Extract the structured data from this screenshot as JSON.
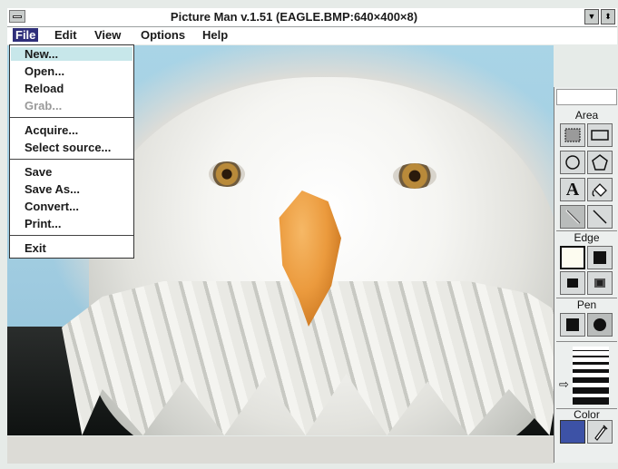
{
  "window": {
    "title": "Picture Man v.1.51 (EAGLE.BMP:640×400×8)",
    "minimize_glyph": "▼",
    "restore_glyph": "⬍",
    "sysmenu_icon": "system-menu-icon"
  },
  "menubar": {
    "items": [
      "File",
      "Edit",
      "View",
      "Options",
      "Help"
    ],
    "active": "File"
  },
  "file_menu": {
    "items": [
      "New...",
      "Open...",
      "Reload",
      "Grab...",
      "Acquire...",
      "Select source...",
      "Save",
      "Save As...",
      "Convert...",
      "Print...",
      "Exit"
    ],
    "disabled": [
      "Grab..."
    ],
    "highlighted": "New..."
  },
  "canvas": {
    "image": "bald eagle portrait",
    "sky_color": "#a9d4e6",
    "beak_color": "#eb9a3d"
  },
  "toolbox": {
    "area_label": "Area",
    "edge_label": "Edge",
    "pen_label": "Pen",
    "color_label": "Color",
    "area_tools": [
      "select-brush-icon",
      "rectangle-icon",
      "circle-icon",
      "polygon-icon",
      "text-icon",
      "fill-icon",
      "brush-icon",
      "line-icon"
    ],
    "text_tool_glyph": "A",
    "current_color": "#3d52a6",
    "pen_arrow": "⇨"
  }
}
